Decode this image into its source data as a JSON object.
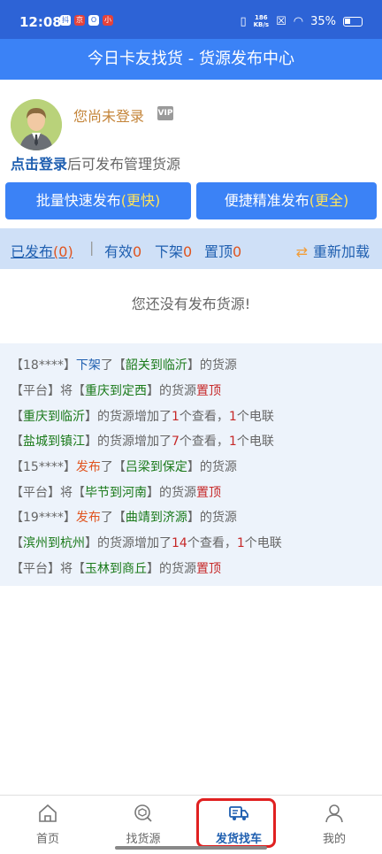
{
  "status_bar": {
    "time": "12:08",
    "app_icons": [
      "抖",
      "京",
      "O",
      "小"
    ],
    "speed_value": "186",
    "speed_unit": "KB/s",
    "battery": "35%"
  },
  "header": {
    "title": "今日卡友找货 - 货源发布中心"
  },
  "profile": {
    "login_status": "您尚未登录",
    "vip_label": "VIP",
    "login_link": "点击登录",
    "login_hint_suffix": "后可发布管理货源"
  },
  "actions": {
    "batch_label": "批量快速发布",
    "batch_accent": "(更快)",
    "precise_label": "便捷精准发布",
    "precise_accent": "(更全)"
  },
  "tabs": {
    "published_label": "已发布",
    "published_count": "(0)",
    "divider": "|",
    "valid_label": "有效",
    "valid_count": "0",
    "removed_label": "下架",
    "removed_count": "0",
    "pinned_label": "置顶",
    "pinned_count": "0",
    "reload_label": "重新加载"
  },
  "empty_message": "您还没有发布货源!",
  "feed": [
    {
      "prefix": "【18****】",
      "action": "下架",
      "mid": "了【",
      "route": "韶关到临沂",
      "suffix": "】的货源"
    },
    {
      "prefix": "【平台】将【",
      "route": "重庆到定西",
      "mid": "】的货源",
      "action": "置顶"
    },
    {
      "prefix": "【",
      "route": "重庆到临沂",
      "mid": "】的货源增加了",
      "views": "1",
      "views_unit": "个查看，",
      "calls": "1",
      "calls_unit": "个电联"
    },
    {
      "prefix": "【",
      "route": "盐城到镇江",
      "mid": "】的货源增加了",
      "views": "7",
      "views_unit": "个查看，",
      "calls": "1",
      "calls_unit": "个电联"
    },
    {
      "prefix": "【15****】",
      "action": "发布",
      "mid": "了【",
      "route": "吕梁到保定",
      "suffix": "】的货源"
    },
    {
      "prefix": "【平台】将【",
      "route": "毕节到河南",
      "mid": "】的货源",
      "action": "置顶"
    },
    {
      "prefix": "【19****】",
      "action": "发布",
      "mid": "了【",
      "route": "曲靖到济源",
      "suffix": "】的货源"
    },
    {
      "prefix": "【",
      "route": "滨州到杭州",
      "mid": "】的货源增加了",
      "views": "14",
      "views_unit": "个查看，",
      "calls": "1",
      "calls_unit": "个电联"
    },
    {
      "prefix": "【平台】将【",
      "route": "玉林到商丘",
      "mid": "】的货源",
      "action": "置顶"
    }
  ],
  "nav": [
    {
      "label": "首页",
      "icon": "home-icon"
    },
    {
      "label": "找货源",
      "icon": "cargo-search-icon"
    },
    {
      "label": "发货找车",
      "icon": "truck-icon"
    },
    {
      "label": "我的",
      "icon": "user-icon"
    }
  ],
  "colors": {
    "header": "#3b82f6",
    "accent": "#ffe45c",
    "route": "#1a7a1a",
    "highlight": "#e02020"
  }
}
